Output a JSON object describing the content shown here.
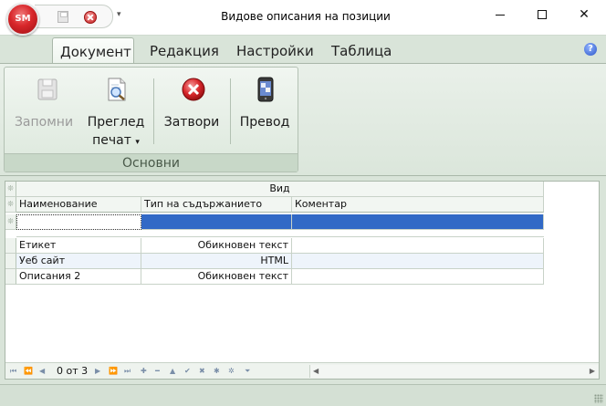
{
  "window": {
    "title": "Видове описания на позиции",
    "app_badge": "SM",
    "qat_dropdown": "▾",
    "minimize": "",
    "maximize": "",
    "close": "✕"
  },
  "tabs": [
    {
      "label": "Документ",
      "active": true
    },
    {
      "label": "Редакция"
    },
    {
      "label": "Настройки"
    },
    {
      "label": "Таблица"
    }
  ],
  "help": "?",
  "ribbon": {
    "group_label": "Основни",
    "buttons": {
      "save": {
        "label": "Запомни",
        "disabled": true
      },
      "preview": {
        "label": "Преглед",
        "label2": "печат",
        "dropdown": "▾"
      },
      "close": {
        "label": "Затвори"
      },
      "translate": {
        "label": "Превод"
      }
    }
  },
  "grid": {
    "band": "Вид",
    "columns": [
      "Наименование",
      "Тип на съдържанието",
      "Коментар"
    ],
    "rows": [
      {
        "name": "Етикет",
        "type": "Обикновен текст",
        "comment": ""
      },
      {
        "name": "Уеб сайт",
        "type": "HTML",
        "comment": ""
      },
      {
        "name": "Описания 2",
        "type": "Обикновен текст",
        "comment": ""
      }
    ],
    "navigator": {
      "record_text": "0 от 3"
    }
  },
  "colors": {
    "accent_green": "#d9e4d9",
    "selection_blue": "#3169c6",
    "close_red": "#d8262a"
  }
}
